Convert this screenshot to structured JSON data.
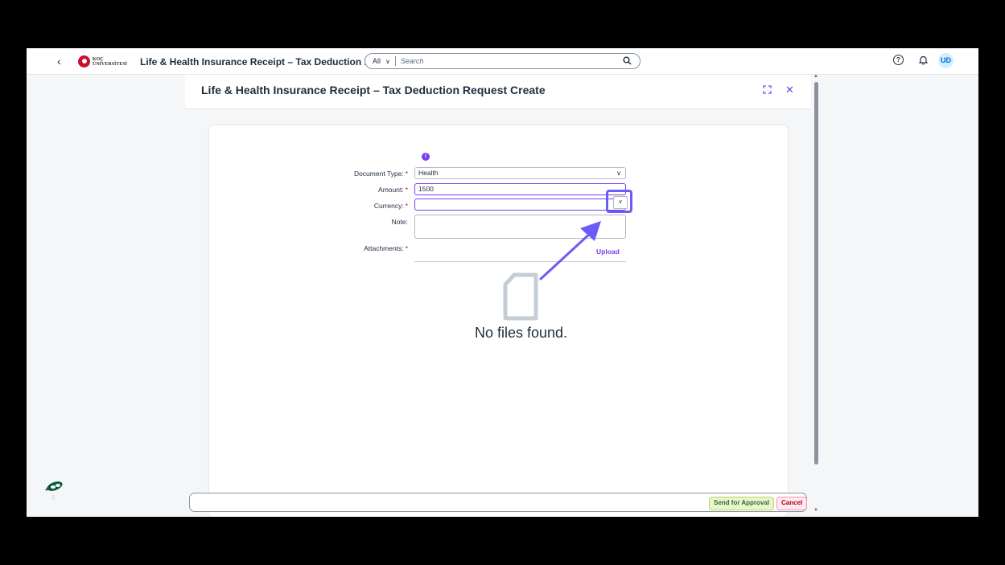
{
  "shellbar": {
    "back_icon": "chevron-left-icon",
    "logo_text_line1": "KOÇ",
    "logo_text_line2": "ÜNİVERSİTESİ",
    "app_title": "Life & Health Insurance Receipt – Tax Deduction Req...",
    "search_scope": "All",
    "search_placeholder": "Search",
    "avatar_initials": "UD"
  },
  "dialog": {
    "title": "Life & Health Insurance Receipt – Tax Deduction Request Create"
  },
  "form": {
    "document_type_label": "Document Type:",
    "document_type_value": "Health",
    "amount_label": "Amount:",
    "amount_value": "1500",
    "currency_label": "Currency:",
    "currency_value": "",
    "note_label": "Note:",
    "note_value": "",
    "attachments_label": "Attachments:",
    "required_marker": "*",
    "upload_label": "Upload",
    "no_files_text": "No files found."
  },
  "footer": {
    "send_label": "Send for Approval",
    "cancel_label": "Cancel"
  },
  "colors": {
    "accent": "#7a3ef0",
    "annotation": "#6c5cf7",
    "required": "#d0022a"
  }
}
